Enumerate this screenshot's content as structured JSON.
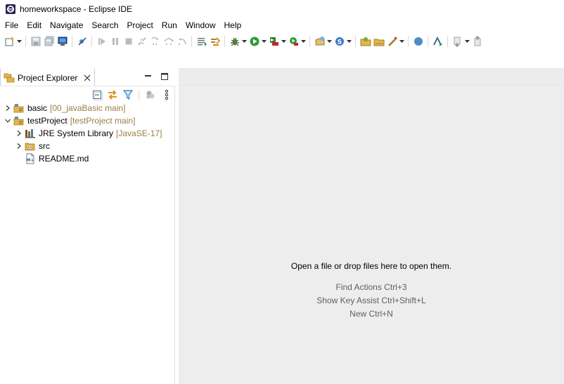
{
  "window": {
    "title": "homeworkspace - Eclipse IDE"
  },
  "menu": [
    "File",
    "Edit",
    "Navigate",
    "Search",
    "Project",
    "Run",
    "Window",
    "Help"
  ],
  "toolbar": {
    "icons": [
      "new-wizard-icon",
      "save-icon",
      "save-all-icon",
      "terminal-icon",
      "skip-breakpoints-icon",
      "resume-icon",
      "suspend-icon",
      "terminate-icon",
      "disconnect-icon",
      "step-into-icon",
      "step-over-icon",
      "step-return-icon",
      "drop-to-frame-icon",
      "use-step-filters-icon",
      "debug-icon",
      "run-icon",
      "coverage-icon",
      "external-tools-icon",
      "new-java-project-icon",
      "new-java-package-icon",
      "open-type-icon",
      "open-task-icon",
      "search-icon",
      "web-browser-icon",
      "git-icon",
      "next-annotation-icon",
      "prev-annotation-icon"
    ]
  },
  "explorer": {
    "tab_label": "Project Explorer",
    "tree": [
      {
        "label": "basic",
        "decoration": "[00_javaBasic main]",
        "level": 0,
        "expanded": false,
        "icon": "git-project-icon"
      },
      {
        "label": "testProject",
        "decoration": "[testProject main]",
        "level": 0,
        "expanded": true,
        "icon": "git-project-icon"
      },
      {
        "label": "JRE System Library",
        "decoration": "[JavaSE-17]",
        "level": 1,
        "expanded": false,
        "icon": "library-icon"
      },
      {
        "label": "src",
        "decoration": "",
        "level": 1,
        "expanded": false,
        "icon": "source-folder-icon"
      },
      {
        "label": "README.md",
        "decoration": "",
        "level": 1,
        "expanded": null,
        "icon": "markdown-file-icon"
      }
    ]
  },
  "editor": {
    "empty_message": "Open a file or drop files here to open them.",
    "hints": [
      "Find Actions Ctrl+3",
      "Show Key Assist Ctrl+Shift+L",
      "New Ctrl+N"
    ]
  },
  "colors": {
    "editor_background": "#ededed",
    "decoration_text": "#9a7d45",
    "hint_text": "#5b6167"
  }
}
